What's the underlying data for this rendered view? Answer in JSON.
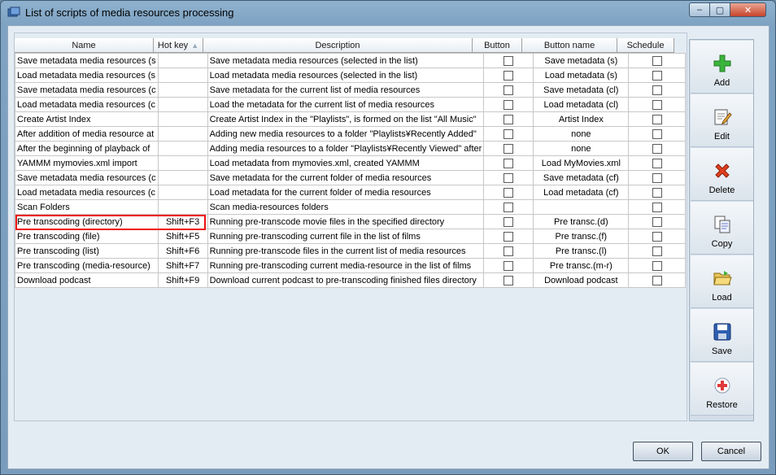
{
  "window": {
    "title": "List of scripts of media resources processing",
    "controls": {
      "minimize": "‒",
      "maximize": "▢",
      "close": "✕"
    }
  },
  "table": {
    "columns": [
      "Name",
      "Hot key",
      "Description",
      "Button",
      "Button name",
      "Schedule"
    ],
    "rows": [
      {
        "name": "Save metadata media resources (s",
        "hotkey": "",
        "description": "Save metadata media resources (selected in the list)",
        "button_name": "Save metadata (s)"
      },
      {
        "name": "Load metadata media resources (s",
        "hotkey": "",
        "description": "Load metadata media resources (selected in the list)",
        "button_name": "Load metadata (s)"
      },
      {
        "name": "Save metadata media resources (c",
        "hotkey": "",
        "description": "Save metadata for the current list of media resources",
        "button_name": "Save metadata (cl)"
      },
      {
        "name": "Load metadata media resources (c",
        "hotkey": "",
        "description": "Load the metadata for the current list of media resources",
        "button_name": "Load metadata (cl)"
      },
      {
        "name": "Create Artist Index",
        "hotkey": "",
        "description": "Create Artist Index in the \"Playlists\", is formed on the list \"All Music\"",
        "button_name": "Artist Index"
      },
      {
        "name": "After addition of media resource at",
        "hotkey": "",
        "description": "Adding new media resources to a folder \"Playlists¥Recently Added\"",
        "button_name": "none"
      },
      {
        "name": "After the beginning of playback of",
        "hotkey": "",
        "description": "Adding media resources to a folder \"Playlists¥Recently Viewed\" after",
        "button_name": "none"
      },
      {
        "name": "YAMMM mymovies.xml import",
        "hotkey": "",
        "description": "Load metadata from mymovies.xml, created YAMMM",
        "button_name": "Load MyMovies.xml"
      },
      {
        "name": "Save metadata media resources (c",
        "hotkey": "",
        "description": "Save metadata for the current folder of media resources",
        "button_name": "Save metadata (cf)"
      },
      {
        "name": "Load metadata media resources (c",
        "hotkey": "",
        "description": "Load metadata for the current folder of media resources",
        "button_name": "Load metadata (cf)"
      },
      {
        "name": "Scan Folders",
        "hotkey": "",
        "description": "Scan media-resources folders",
        "button_name": ""
      },
      {
        "name": "Pre transcoding (directory)",
        "hotkey": "Shift+F3",
        "description": "Running pre-transcode movie files in the specified directory",
        "button_name": "Pre transc.(d)"
      },
      {
        "name": "Pre transcoding (file)",
        "hotkey": "Shift+F5",
        "description": "Running pre-transcoding current file in the list of films",
        "button_name": "Pre transc.(f)"
      },
      {
        "name": "Pre transcoding (list)",
        "hotkey": "Shift+F6",
        "description": "Running pre-transcode files in the current list of media resources",
        "button_name": "Pre transc.(l)"
      },
      {
        "name": "Pre transcoding (media-resource)",
        "hotkey": "Shift+F7",
        "description": "Running pre-transcoding current media-resource in the list of films",
        "button_name": "Pre transc.(m-r)"
      },
      {
        "name": "Download podcast",
        "hotkey": "Shift+F9",
        "description": "Download current podcast to pre-transcoding finished files directory",
        "button_name": "Download podcast"
      }
    ]
  },
  "sidebar": {
    "buttons": [
      {
        "label": "Add",
        "icon": "plus-icon"
      },
      {
        "label": "Edit",
        "icon": "edit-icon"
      },
      {
        "label": "Delete",
        "icon": "delete-icon"
      },
      {
        "label": "Copy",
        "icon": "copy-icon"
      },
      {
        "label": "Load",
        "icon": "folder-open-icon"
      },
      {
        "label": "Save",
        "icon": "floppy-icon"
      },
      {
        "label": "Restore",
        "icon": "restore-icon"
      }
    ]
  },
  "dialog": {
    "ok": "OK",
    "cancel": "Cancel"
  },
  "colors": {
    "highlight": "#ee1111",
    "add": "#3cb43c",
    "delete": "#e0401e"
  }
}
